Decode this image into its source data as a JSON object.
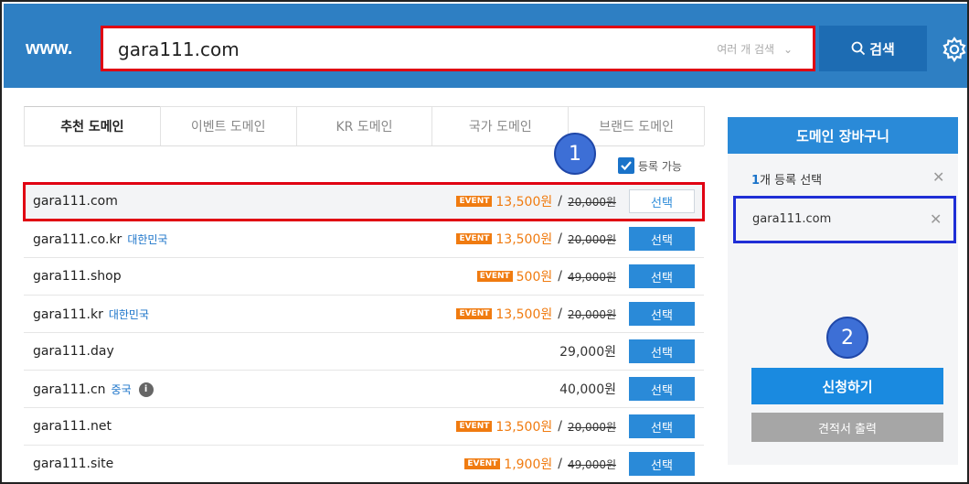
{
  "header": {
    "prefix": "www.",
    "search_value": "gara111.com",
    "multi_search_label": "여러 개 검색",
    "search_button_label": "검색"
  },
  "tabs": [
    {
      "label": "추천 도메인",
      "active": true
    },
    {
      "label": "이벤트 도메인",
      "active": false
    },
    {
      "label": "KR 도메인",
      "active": false
    },
    {
      "label": "국가 도메인",
      "active": false
    },
    {
      "label": "브랜드 도메인",
      "active": false
    }
  ],
  "annotations": {
    "badge1": "1",
    "badge2": "2"
  },
  "filter": {
    "checkbox_label": "등록 가능",
    "checked": true
  },
  "select_label": "선택",
  "event_label": "EVENT",
  "slash": "/",
  "domains": [
    {
      "name": "gara111.com",
      "country": "",
      "sale": "13,500원",
      "orig": "20,000원",
      "price": ""
    },
    {
      "name": "gara111.co.kr",
      "country": "대한민국",
      "sale": "13,500원",
      "orig": "20,000원",
      "price": ""
    },
    {
      "name": "gara111.shop",
      "country": "",
      "sale": "500원",
      "orig": "49,000원",
      "price": ""
    },
    {
      "name": "gara111.kr",
      "country": "대한민국",
      "sale": "13,500원",
      "orig": "20,000원",
      "price": ""
    },
    {
      "name": "gara111.day",
      "country": "",
      "sale": "",
      "orig": "",
      "price": "29,000원"
    },
    {
      "name": "gara111.cn",
      "country": "중국",
      "sale": "",
      "orig": "",
      "price": "40,000원"
    },
    {
      "name": "gara111.net",
      "country": "",
      "sale": "13,500원",
      "orig": "20,000원",
      "price": ""
    },
    {
      "name": "gara111.site",
      "country": "",
      "sale": "1,900원",
      "orig": "49,000원",
      "price": ""
    }
  ],
  "cart": {
    "title": "도메인 장바구니",
    "count_num": "1",
    "count_text": "개 등록 선택",
    "item": "gara111.com",
    "apply_label": "신청하기",
    "quote_label": "견적서 출력"
  },
  "colors": {
    "header_bg": "#2e7fc3",
    "accent": "#2a8ad8",
    "event": "#f07b10",
    "highlight_red": "#e00012",
    "highlight_blue": "#1f2ed6"
  }
}
